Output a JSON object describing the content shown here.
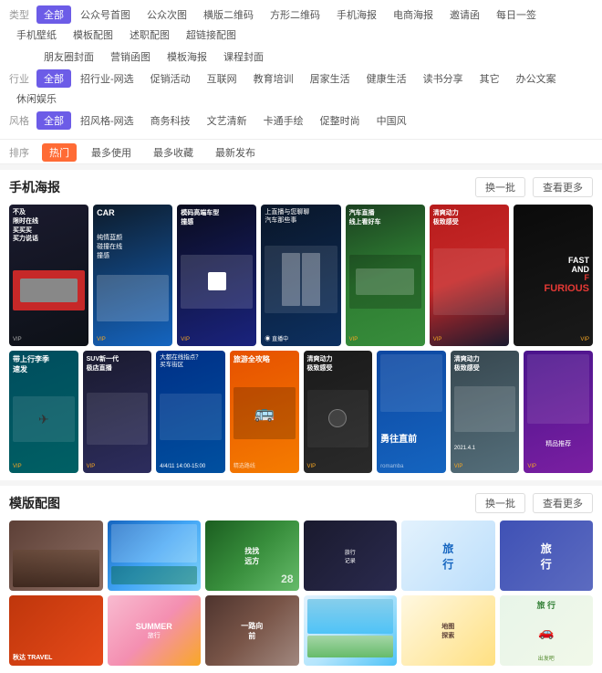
{
  "filters": {
    "type_label": "类型",
    "type_items": [
      {
        "label": "全部",
        "active": true
      },
      {
        "label": "公众号首图",
        "active": false
      },
      {
        "label": "公众次图",
        "active": false
      },
      {
        "label": "横版二维码",
        "active": false
      },
      {
        "label": "方形二维码",
        "active": false
      },
      {
        "label": "手机海报",
        "active": false
      },
      {
        "label": "电商海报",
        "active": false
      },
      {
        "label": "邀请函",
        "active": false
      },
      {
        "label": false
      },
      {
        "label": "手机壁纸",
        "active": false
      },
      {
        "label": "模板配图",
        "active": false
      },
      {
        "label": "述职配图",
        "active": false
      },
      {
        "label": "超链接配图",
        "active": false
      }
    ],
    "type_items2": [
      {
        "label": "朋友圈封面",
        "active": false
      },
      {
        "label": "营销函图",
        "active": false
      },
      {
        "label": "模板海报",
        "active": false
      },
      {
        "label": "课程封面",
        "active": false
      }
    ],
    "industry_label": "行业",
    "industry_items": [
      {
        "label": "全部",
        "active": true
      },
      {
        "label": "招行业-网选",
        "active": false
      },
      {
        "label": "促销活动",
        "active": false
      },
      {
        "label": "互联网",
        "active": false
      },
      {
        "label": "教育培训",
        "active": false
      },
      {
        "label": "居家生活",
        "active": false
      },
      {
        "label": "健康生活",
        "active": false
      },
      {
        "label": "读书分享",
        "active": false
      },
      {
        "label": "其它",
        "active": false
      },
      {
        "label": "办公文案",
        "active": false
      },
      {
        "label": "休闲娱乐",
        "active": false
      }
    ],
    "style_label": "风格",
    "style_items": [
      {
        "label": "全部",
        "active": true
      },
      {
        "label": "招风格-网选",
        "active": false
      },
      {
        "label": "商务科技",
        "active": false
      },
      {
        "label": "文艺清新",
        "active": false
      },
      {
        "label": "卡通手绘",
        "active": false
      },
      {
        "label": "促整时尚",
        "active": false
      },
      {
        "label": "中国风",
        "active": false
      }
    ],
    "sort_label": "排序",
    "sort_items": [
      {
        "label": "热门",
        "active": true
      },
      {
        "label": "最多使用",
        "active": false
      },
      {
        "label": "最多收藏",
        "active": false
      },
      {
        "label": "最新发布",
        "active": false
      }
    ]
  },
  "sections": {
    "phone_poster": {
      "title": "手机海报",
      "btn1": "换一批",
      "btn2": "查看更多",
      "cards": [
        {
          "id": 1,
          "text": "不及\n限时在线\n买买买\n买力说话",
          "bg": "dark",
          "color": "white",
          "accent": "#e53935"
        },
        {
          "id": 2,
          "text": "纯情蓝颜\n碰撞在线\n撞感",
          "bg": "blue_car",
          "color": "white"
        },
        {
          "id": 3,
          "text": "模码高端车型\n撞感",
          "bg": "purple_code",
          "color": "white"
        },
        {
          "id": 4,
          "text": "上直播与您聊聊\n汽车那些事",
          "bg": "blue_studio",
          "color": "white"
        },
        {
          "id": 5,
          "text": "汽车直播\n线上看好车",
          "bg": "green_outdoor",
          "color": "white"
        },
        {
          "id": 6,
          "text": "清爽动力\n极致感受",
          "bg": "red_car",
          "color": "white"
        },
        {
          "id": 7,
          "text": "FAST AND FURIOUS",
          "bg": "dark_fast",
          "color": "white"
        },
        {
          "id": 8,
          "text": "带上行李季\n速发",
          "bg": "cyan_travel",
          "color": "white"
        },
        {
          "id": 9,
          "text": "SUV新一代\n极店直播",
          "bg": "dark_suv",
          "color": "white"
        },
        {
          "id": 10,
          "text": "大都在线指点？\n买车街区\n4/4/11 14:00-15:00",
          "bg": "blue_online",
          "color": "white"
        },
        {
          "id": 11,
          "text": "旅游全攻略",
          "bg": "orange_tour",
          "color": "white"
        },
        {
          "id": 12,
          "text": "清爽动力\n极致感受",
          "bg": "dark_speaker",
          "color": "white"
        },
        {
          "id": 13,
          "text": "勇往直前",
          "bg": "blue_brave",
          "color": "white"
        },
        {
          "id": 14,
          "text": "清爽动力\n极致感受\n2021.4.1",
          "bg": "dark_silver",
          "color": "white"
        },
        {
          "id": 15,
          "text": "",
          "bg": "purple_hand",
          "color": "white"
        }
      ]
    },
    "template_config": {
      "title": "模版配图",
      "btn1": "换一批",
      "btn2": "查看更多",
      "cards": [
        {
          "id": 1,
          "text": "",
          "bg": "brown_road",
          "color": "white"
        },
        {
          "id": 2,
          "text": "",
          "bg": "sky_blue",
          "color": "white"
        },
        {
          "id": 3,
          "text": "找找\n远方\n28",
          "bg": "mountain",
          "color": "white"
        },
        {
          "id": 4,
          "text": "",
          "bg": "gold_star",
          "color": "#333"
        },
        {
          "id": 5,
          "text": "旅\n行",
          "bg": "light_blue",
          "color": "#1565c0"
        },
        {
          "id": 6,
          "text": "旅\n行",
          "bg": "vintage_blue",
          "color": "white"
        },
        {
          "id": 7,
          "text": "秋达 TRAVEL",
          "bg": "autumn",
          "color": "white"
        },
        {
          "id": 8,
          "text": "SUMMER\n旅行",
          "bg": "summer",
          "color": "white"
        },
        {
          "id": 9,
          "text": "一路向\n前",
          "bg": "desert",
          "color": "white"
        },
        {
          "id": 10,
          "text": "",
          "bg": "lake",
          "color": "white"
        },
        {
          "id": 11,
          "text": "",
          "bg": "map",
          "color": "white"
        },
        {
          "id": 12,
          "text": "旅\n行",
          "bg": "light_travel",
          "color": "#333"
        }
      ]
    }
  }
}
